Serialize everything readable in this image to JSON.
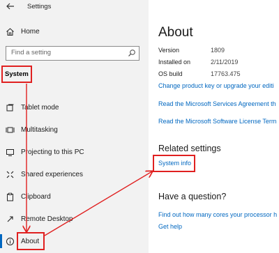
{
  "window": {
    "title": "Settings"
  },
  "sidebar": {
    "home_label": "Home",
    "search_placeholder": "Find a setting",
    "system_label": "System",
    "items": [
      {
        "label": "Tablet mode",
        "icon": "tablet-mode-icon"
      },
      {
        "label": "Multitasking",
        "icon": "multitasking-icon"
      },
      {
        "label": "Projecting to this PC",
        "icon": "projecting-icon"
      },
      {
        "label": "Shared experiences",
        "icon": "shared-experiences-icon"
      },
      {
        "label": "Clipboard",
        "icon": "clipboard-icon"
      },
      {
        "label": "Remote Desktop",
        "icon": "remote-desktop-icon"
      },
      {
        "label": "About",
        "icon": "info-icon"
      }
    ]
  },
  "main": {
    "title": "About",
    "specs": [
      {
        "label": "Version",
        "value": "1809"
      },
      {
        "label": "Installed on",
        "value": "2/11/2019"
      },
      {
        "label": "OS build",
        "value": "17763.475"
      }
    ],
    "link_product_key": "Change product key or upgrade your editi",
    "link_services_agreement": "Read the Microsoft Services Agreement th",
    "link_license_terms": "Read the Microsoft Software License Term",
    "related_title": "Related settings",
    "link_system_info": "System info",
    "question_title": "Have a question?",
    "link_cores": "Find out how many cores your processor h",
    "link_help": "Get help"
  },
  "colors": {
    "accent": "#0067c0",
    "annotation": "#e02020",
    "sidebar_bg": "#f2f2f2"
  }
}
